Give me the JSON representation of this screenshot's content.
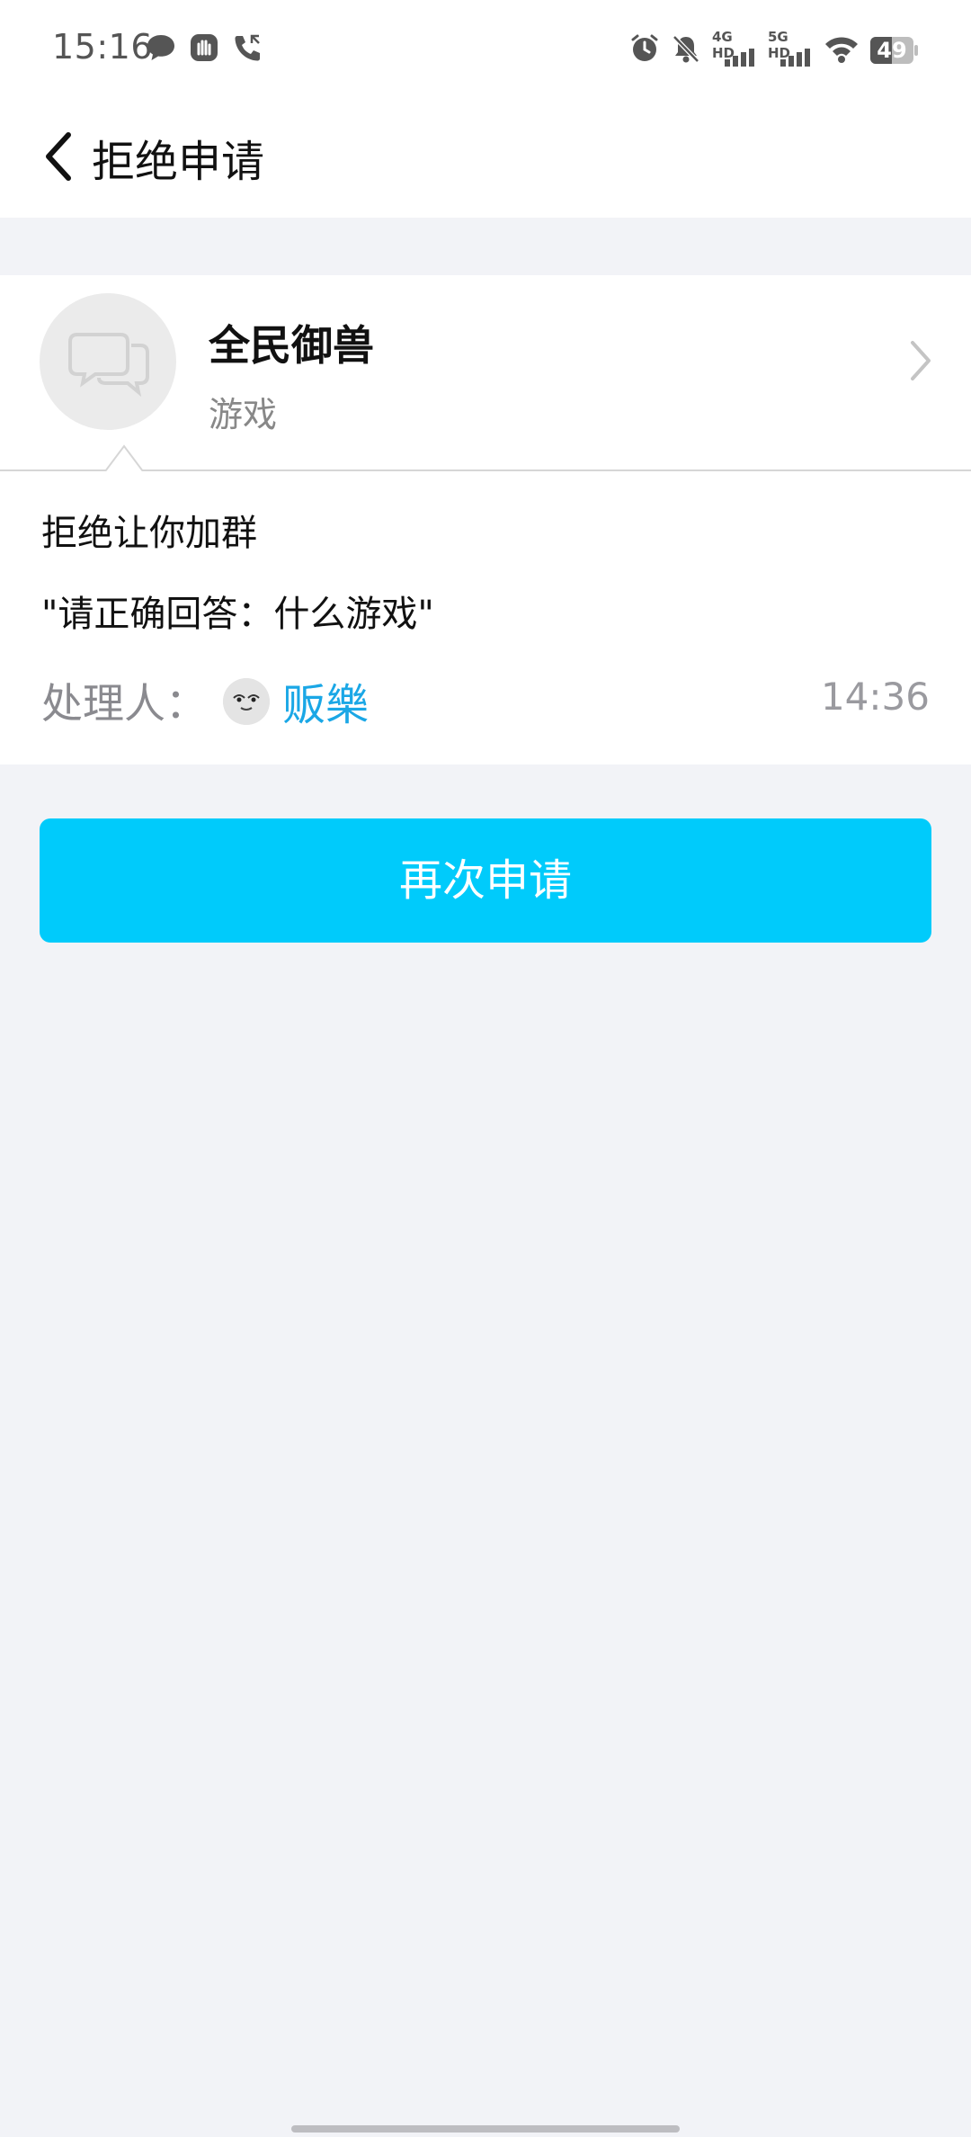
{
  "status_bar": {
    "time": "15:16",
    "left_icons": [
      "message-bubble-icon",
      "hand-icon",
      "missed-call-icon"
    ],
    "right_icons": [
      "alarm-icon",
      "mute-bell-icon",
      "signal-4g-icon",
      "signal-5g-icon",
      "wifi-icon",
      "battery-icon"
    ],
    "sig1_label": "4G HD",
    "sig2_label": "5G HD",
    "battery_level": "49"
  },
  "header": {
    "title": "拒绝申请"
  },
  "group": {
    "name": "全民御兽",
    "subtitle": "游戏"
  },
  "message": {
    "status": "拒绝让你加群",
    "quote": "\"请正确回答：什么游戏\"",
    "handler_label": "处理人：",
    "handler_name": "贩樂",
    "time": "14:36"
  },
  "actions": {
    "reapply_label": "再次申请"
  },
  "colors": {
    "accent": "#00cbfb",
    "link": "#1aa7e6",
    "background": "#f2f3f7"
  }
}
